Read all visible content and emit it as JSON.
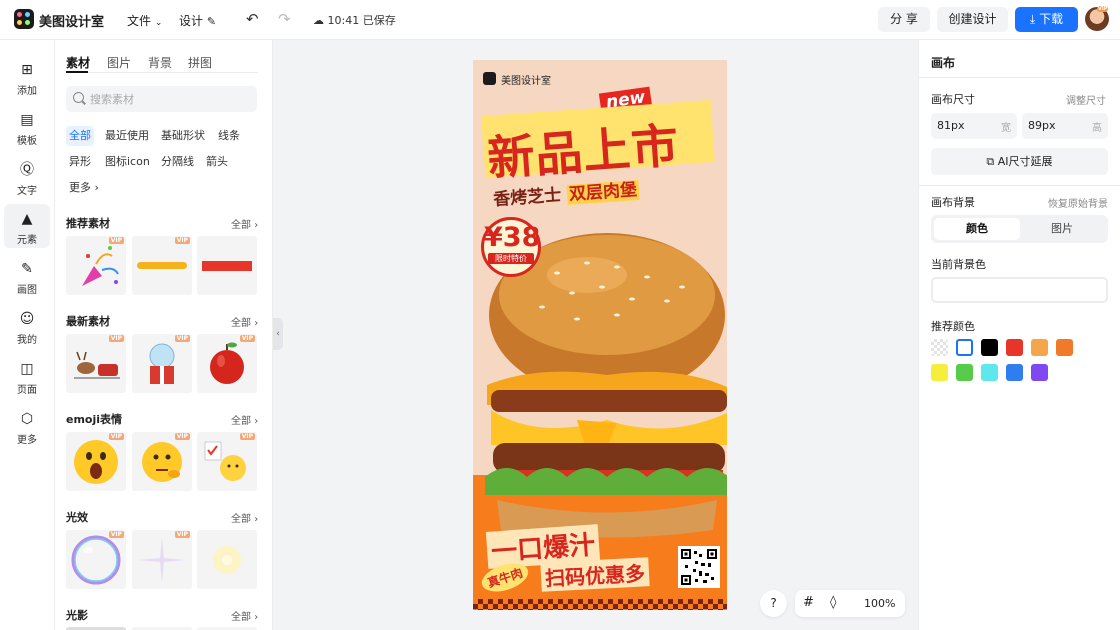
{
  "topbar": {
    "app_name": "美图设计室",
    "file_menu": "文件",
    "design_menu": "设计",
    "save_status": "10:41 已保存",
    "share": "分 享",
    "create_design": "创建设计",
    "download": "下载",
    "avatar_badge": "VIP"
  },
  "rail": {
    "items": [
      {
        "label": "添加",
        "icon": "plus-square-icon"
      },
      {
        "label": "模板",
        "icon": "template-icon"
      },
      {
        "label": "文字",
        "icon": "text-icon"
      },
      {
        "label": "元素",
        "icon": "shapes-icon"
      },
      {
        "label": "画图",
        "icon": "draw-icon"
      },
      {
        "label": "我的",
        "icon": "user-icon"
      },
      {
        "label": "页面",
        "icon": "page-add-icon"
      },
      {
        "label": "更多",
        "icon": "cube-icon"
      }
    ]
  },
  "panel": {
    "tabs": [
      "素材",
      "图片",
      "背景",
      "拼图"
    ],
    "search_placeholder": "搜索素材",
    "chips": [
      "全部",
      "最近使用",
      "基础形状",
      "线条",
      "异形",
      "图标icon",
      "分隔线",
      "箭头",
      "更多"
    ],
    "vip": "VIP",
    "all_label": "全部",
    "sections": [
      "推荐素材",
      "最新素材",
      "emoji表情",
      "光效",
      "光影"
    ]
  },
  "poster": {
    "brand": "美图设计室",
    "badge_new": "new",
    "headline": "新品上市",
    "subtitle_a": "香烤芝士",
    "subtitle_b": "双层肉堡",
    "price": "¥38",
    "price_tag": "限时特价",
    "cta_line1": "一口爆汁",
    "cta_tag": "真牛肉",
    "cta_line2": "扫码优惠多"
  },
  "canvas_controls": {
    "help": "?",
    "zoom": "100%"
  },
  "right_panel": {
    "title": "画布",
    "size_label": "画布尺寸",
    "size_link": "调整尺寸",
    "width_value": "81px",
    "width_unit": "宽",
    "height_value": "89px",
    "height_unit": "高",
    "ai_button": "AI尺寸延展",
    "bg_label": "画布背景",
    "bg_reset": "恢复原始背景",
    "seg_color": "颜色",
    "seg_image": "图片",
    "current_bg_label": "当前背景色",
    "recommended_label": "推荐颜色",
    "swatches": [
      "transparent",
      "#ffffff",
      "#000000",
      "#e8352a",
      "#f5a64a",
      "#f07a2a",
      "#f5ee3c",
      "#56cc4a",
      "#5ee8ee",
      "#2f7ef0",
      "#8048f0"
    ]
  }
}
